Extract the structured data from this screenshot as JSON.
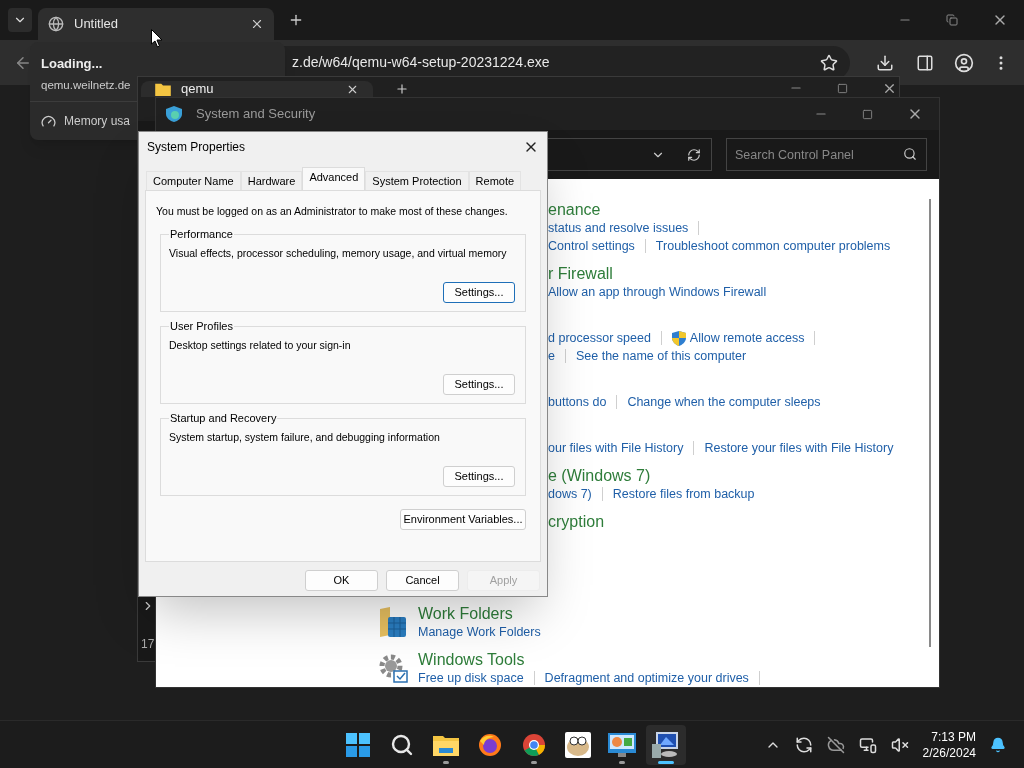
{
  "browser": {
    "tabs": [
      {
        "title": "Untitled",
        "selected": true
      }
    ],
    "address": "z.de/w64/qemu-w64-setup-20231224.exe",
    "hover_card": {
      "title": "Loading...",
      "url": "qemu.weilnetz.de",
      "memory": "Memory usa"
    }
  },
  "explorer": {
    "tab": "qemu",
    "sidebar_text": "17"
  },
  "control_panel": {
    "title": "System and Security",
    "search": {
      "placeholder": "Search Control Panel"
    },
    "clipped_sections": [
      {
        "heading": "enance",
        "rows": [
          [
            {
              "text": "status and resolve issues",
              "shield": false,
              "separator": true
            }
          ],
          [
            {
              "text": "Control settings",
              "shield": false,
              "separator": true
            },
            {
              "text": "Troubleshoot common computer problems",
              "shield": false,
              "separator": false
            }
          ]
        ]
      },
      {
        "heading": "r Firewall",
        "rows": [
          [
            {
              "text": "Allow an app through Windows Firewall",
              "shield": false,
              "separator": false
            }
          ]
        ]
      },
      {
        "rows": [
          [
            {
              "text": "d processor speed",
              "shield": false,
              "separator": true
            },
            {
              "text": "Allow remote access",
              "shield": true,
              "separator": true
            }
          ],
          [
            {
              "text": "e",
              "shield": false,
              "separator": true
            },
            {
              "text": "See the name of this computer",
              "shield": false,
              "separator": false
            }
          ]
        ]
      },
      {
        "rows": [
          [
            {
              "text": "buttons do",
              "shield": false,
              "separator": true
            },
            {
              "text": "Change when the computer sleeps",
              "shield": false,
              "separator": false
            }
          ]
        ]
      },
      {
        "rows": [
          [
            {
              "text": "our files with File History",
              "shield": false,
              "separator": true
            },
            {
              "text": "Restore your files with File History",
              "shield": false,
              "separator": false
            }
          ]
        ]
      },
      {
        "heading": "e (Windows 7)",
        "rows": [
          [
            {
              "text": "dows 7)",
              "shield": false,
              "separator": true
            },
            {
              "text": "Restore files from backup",
              "shield": false,
              "separator": false
            }
          ]
        ]
      },
      {
        "heading": "cryption"
      }
    ],
    "icon_sections": [
      {
        "kind": "work_folders",
        "heading": "Work Folders",
        "rows": [
          [
            {
              "text": "Manage Work Folders",
              "shield": false,
              "separator": false
            }
          ]
        ]
      },
      {
        "kind": "tools",
        "heading": "Windows Tools",
        "rows": [
          [
            {
              "text": "Free up disk space",
              "shield": false,
              "separator": true
            },
            {
              "text": "Defragment and optimize your drives",
              "shield": false,
              "separator": true
            }
          ]
        ]
      }
    ]
  },
  "dialog": {
    "title": "System Properties",
    "tabs": [
      {
        "label": "Computer Name",
        "selected": false
      },
      {
        "label": "Hardware",
        "selected": false
      },
      {
        "label": "Advanced",
        "selected": true
      },
      {
        "label": "System Protection",
        "selected": false
      },
      {
        "label": "Remote",
        "selected": false
      }
    ],
    "notice": "You must be logged on as an Administrator to make most of these changes.",
    "groups": [
      {
        "title": "Performance",
        "description": "Visual effects, processor scheduling, memory usage, and virtual memory",
        "button": "Settings...",
        "focused": true
      },
      {
        "title": "User Profiles",
        "description": "Desktop settings related to your sign-in",
        "button": "Settings...",
        "focused": false
      },
      {
        "title": "Startup and Recovery",
        "description": "System startup, system failure, and debugging information",
        "button": "Settings...",
        "focused": false
      }
    ],
    "env_button": "Environment Variables...",
    "buttons": [
      {
        "label": "OK",
        "disabled": false
      },
      {
        "label": "Cancel",
        "disabled": false
      },
      {
        "label": "Apply",
        "disabled": true
      }
    ]
  },
  "taskbar": {
    "apps": [
      {
        "running": false,
        "selected": false
      },
      {
        "running": false,
        "selected": false
      },
      {
        "running": true,
        "selected": false
      },
      {
        "running": false,
        "selected": false
      },
      {
        "running": true,
        "selected": false
      },
      {
        "running": false,
        "selected": false
      },
      {
        "running": true,
        "selected": false
      },
      {
        "running": true,
        "selected": true
      }
    ],
    "time": "7:13 PM",
    "date": "2/26/2024"
  }
}
